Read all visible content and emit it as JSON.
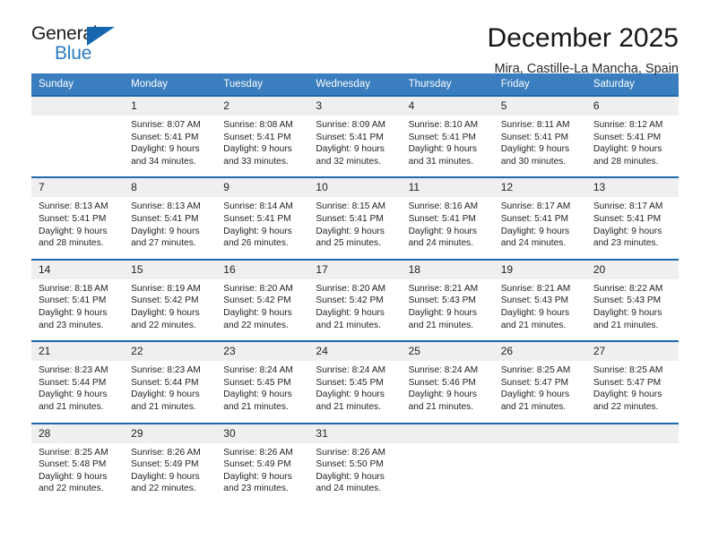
{
  "brand": {
    "name_top": "General",
    "name_bottom": "Blue",
    "triangle_icon": "triangle-icon",
    "colors": {
      "dark": "#1c1c1c",
      "blue": "#2b7cc4",
      "triangle": "#1667b0"
    }
  },
  "header": {
    "title": "December 2025",
    "location": "Mira, Castille-La Mancha, Spain"
  },
  "theme": {
    "header_bg": "#3a7ebf",
    "week_rule": "#1c69ac",
    "daynum_bg": "#efefef",
    "text": "#232323"
  },
  "weekdays": [
    "Sunday",
    "Monday",
    "Tuesday",
    "Wednesday",
    "Thursday",
    "Friday",
    "Saturday"
  ],
  "weeks": [
    [
      {
        "day": "",
        "sunrise": "",
        "sunset": "",
        "daylight": "",
        "empty": true
      },
      {
        "day": "1",
        "sunrise": "Sunrise: 8:07 AM",
        "sunset": "Sunset: 5:41 PM",
        "daylight": "Daylight: 9 hours and 34 minutes."
      },
      {
        "day": "2",
        "sunrise": "Sunrise: 8:08 AM",
        "sunset": "Sunset: 5:41 PM",
        "daylight": "Daylight: 9 hours and 33 minutes."
      },
      {
        "day": "3",
        "sunrise": "Sunrise: 8:09 AM",
        "sunset": "Sunset: 5:41 PM",
        "daylight": "Daylight: 9 hours and 32 minutes."
      },
      {
        "day": "4",
        "sunrise": "Sunrise: 8:10 AM",
        "sunset": "Sunset: 5:41 PM",
        "daylight": "Daylight: 9 hours and 31 minutes."
      },
      {
        "day": "5",
        "sunrise": "Sunrise: 8:11 AM",
        "sunset": "Sunset: 5:41 PM",
        "daylight": "Daylight: 9 hours and 30 minutes."
      },
      {
        "day": "6",
        "sunrise": "Sunrise: 8:12 AM",
        "sunset": "Sunset: 5:41 PM",
        "daylight": "Daylight: 9 hours and 28 minutes."
      }
    ],
    [
      {
        "day": "7",
        "sunrise": "Sunrise: 8:13 AM",
        "sunset": "Sunset: 5:41 PM",
        "daylight": "Daylight: 9 hours and 28 minutes."
      },
      {
        "day": "8",
        "sunrise": "Sunrise: 8:13 AM",
        "sunset": "Sunset: 5:41 PM",
        "daylight": "Daylight: 9 hours and 27 minutes."
      },
      {
        "day": "9",
        "sunrise": "Sunrise: 8:14 AM",
        "sunset": "Sunset: 5:41 PM",
        "daylight": "Daylight: 9 hours and 26 minutes."
      },
      {
        "day": "10",
        "sunrise": "Sunrise: 8:15 AM",
        "sunset": "Sunset: 5:41 PM",
        "daylight": "Daylight: 9 hours and 25 minutes."
      },
      {
        "day": "11",
        "sunrise": "Sunrise: 8:16 AM",
        "sunset": "Sunset: 5:41 PM",
        "daylight": "Daylight: 9 hours and 24 minutes."
      },
      {
        "day": "12",
        "sunrise": "Sunrise: 8:17 AM",
        "sunset": "Sunset: 5:41 PM",
        "daylight": "Daylight: 9 hours and 24 minutes."
      },
      {
        "day": "13",
        "sunrise": "Sunrise: 8:17 AM",
        "sunset": "Sunset: 5:41 PM",
        "daylight": "Daylight: 9 hours and 23 minutes."
      }
    ],
    [
      {
        "day": "14",
        "sunrise": "Sunrise: 8:18 AM",
        "sunset": "Sunset: 5:41 PM",
        "daylight": "Daylight: 9 hours and 23 minutes."
      },
      {
        "day": "15",
        "sunrise": "Sunrise: 8:19 AM",
        "sunset": "Sunset: 5:42 PM",
        "daylight": "Daylight: 9 hours and 22 minutes."
      },
      {
        "day": "16",
        "sunrise": "Sunrise: 8:20 AM",
        "sunset": "Sunset: 5:42 PM",
        "daylight": "Daylight: 9 hours and 22 minutes."
      },
      {
        "day": "17",
        "sunrise": "Sunrise: 8:20 AM",
        "sunset": "Sunset: 5:42 PM",
        "daylight": "Daylight: 9 hours and 21 minutes."
      },
      {
        "day": "18",
        "sunrise": "Sunrise: 8:21 AM",
        "sunset": "Sunset: 5:43 PM",
        "daylight": "Daylight: 9 hours and 21 minutes."
      },
      {
        "day": "19",
        "sunrise": "Sunrise: 8:21 AM",
        "sunset": "Sunset: 5:43 PM",
        "daylight": "Daylight: 9 hours and 21 minutes."
      },
      {
        "day": "20",
        "sunrise": "Sunrise: 8:22 AM",
        "sunset": "Sunset: 5:43 PM",
        "daylight": "Daylight: 9 hours and 21 minutes."
      }
    ],
    [
      {
        "day": "21",
        "sunrise": "Sunrise: 8:23 AM",
        "sunset": "Sunset: 5:44 PM",
        "daylight": "Daylight: 9 hours and 21 minutes."
      },
      {
        "day": "22",
        "sunrise": "Sunrise: 8:23 AM",
        "sunset": "Sunset: 5:44 PM",
        "daylight": "Daylight: 9 hours and 21 minutes."
      },
      {
        "day": "23",
        "sunrise": "Sunrise: 8:24 AM",
        "sunset": "Sunset: 5:45 PM",
        "daylight": "Daylight: 9 hours and 21 minutes."
      },
      {
        "day": "24",
        "sunrise": "Sunrise: 8:24 AM",
        "sunset": "Sunset: 5:45 PM",
        "daylight": "Daylight: 9 hours and 21 minutes."
      },
      {
        "day": "25",
        "sunrise": "Sunrise: 8:24 AM",
        "sunset": "Sunset: 5:46 PM",
        "daylight": "Daylight: 9 hours and 21 minutes."
      },
      {
        "day": "26",
        "sunrise": "Sunrise: 8:25 AM",
        "sunset": "Sunset: 5:47 PM",
        "daylight": "Daylight: 9 hours and 21 minutes."
      },
      {
        "day": "27",
        "sunrise": "Sunrise: 8:25 AM",
        "sunset": "Sunset: 5:47 PM",
        "daylight": "Daylight: 9 hours and 22 minutes."
      }
    ],
    [
      {
        "day": "28",
        "sunrise": "Sunrise: 8:25 AM",
        "sunset": "Sunset: 5:48 PM",
        "daylight": "Daylight: 9 hours and 22 minutes."
      },
      {
        "day": "29",
        "sunrise": "Sunrise: 8:26 AM",
        "sunset": "Sunset: 5:49 PM",
        "daylight": "Daylight: 9 hours and 22 minutes."
      },
      {
        "day": "30",
        "sunrise": "Sunrise: 8:26 AM",
        "sunset": "Sunset: 5:49 PM",
        "daylight": "Daylight: 9 hours and 23 minutes."
      },
      {
        "day": "31",
        "sunrise": "Sunrise: 8:26 AM",
        "sunset": "Sunset: 5:50 PM",
        "daylight": "Daylight: 9 hours and 24 minutes."
      },
      {
        "day": "",
        "sunrise": "",
        "sunset": "",
        "daylight": "",
        "empty": true
      },
      {
        "day": "",
        "sunrise": "",
        "sunset": "",
        "daylight": "",
        "empty": true
      },
      {
        "day": "",
        "sunrise": "",
        "sunset": "",
        "daylight": "",
        "empty": true
      }
    ]
  ]
}
